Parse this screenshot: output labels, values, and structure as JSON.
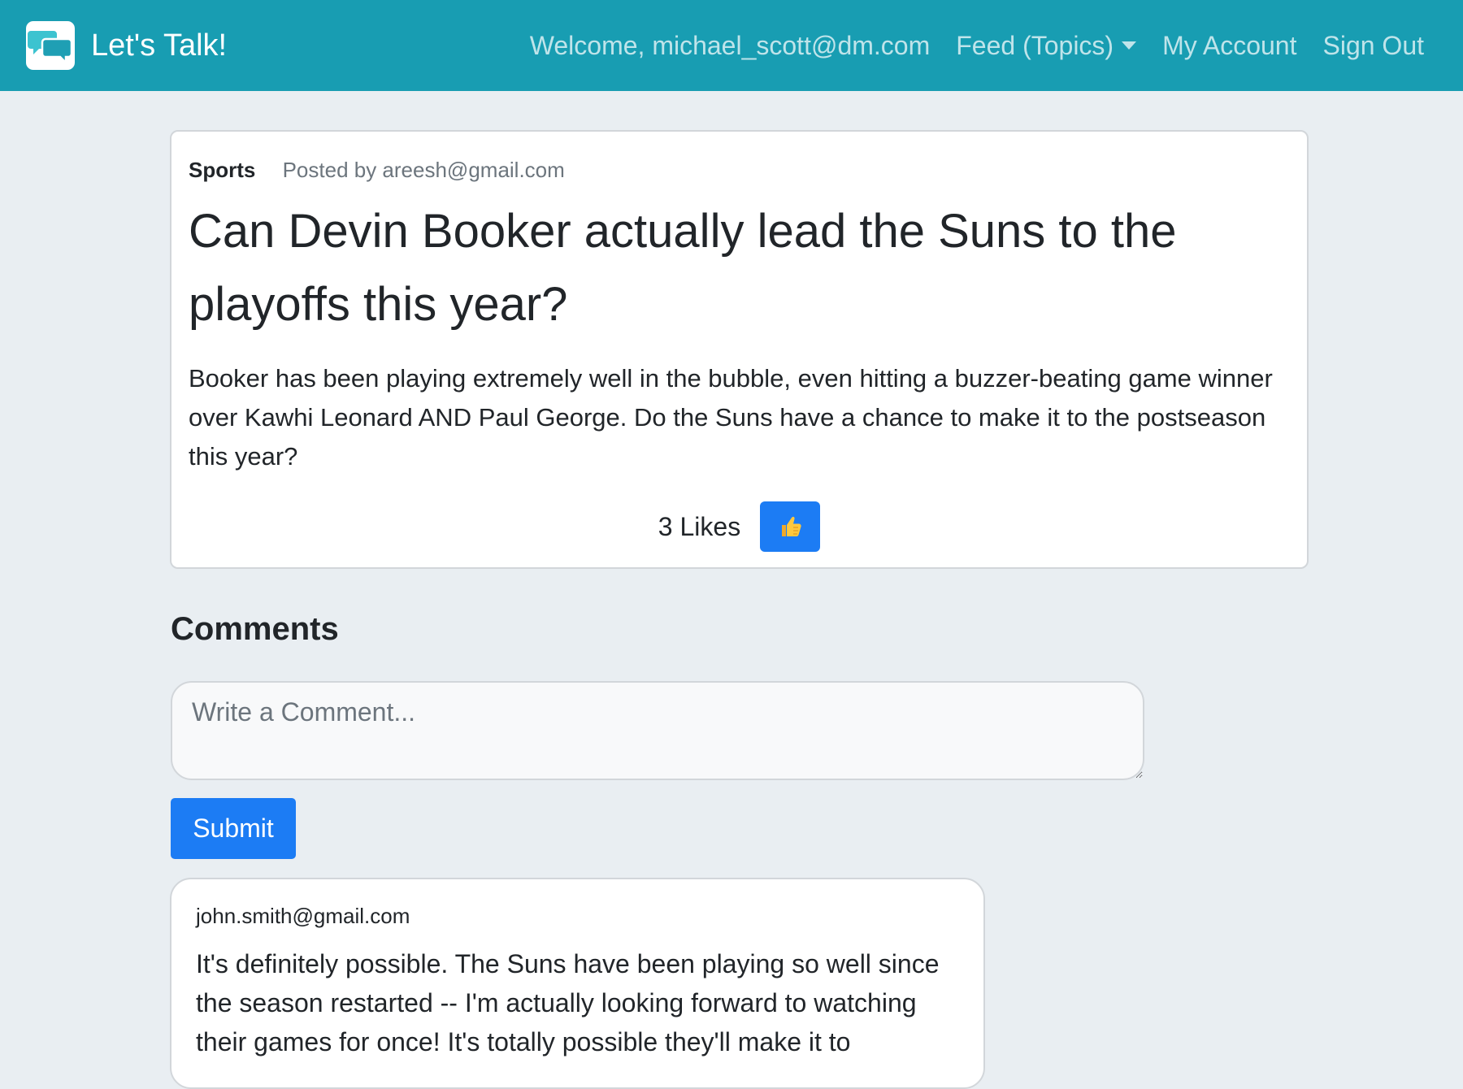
{
  "navbar": {
    "brand": "Let's Talk!",
    "welcome": "Welcome, michael_scott@dm.com",
    "feed": "Feed (Topics)",
    "account": "My Account",
    "signout": "Sign Out",
    "color": "#189db2"
  },
  "post": {
    "topic": "Sports",
    "author": "Posted by areesh@gmail.com",
    "title": "Can Devin Booker actually lead the Suns to the playoffs this year?",
    "body": "Booker has been playing extremely well in the bubble, even hitting a buzzer-beating game winner over Kawhi Leonard AND Paul George. Do the Suns have a chance to make it to the postseason this year?",
    "likes": "3 Likes",
    "like_icon": "thumbs-up-icon"
  },
  "comments": {
    "heading": "Comments",
    "placeholder": "Write a Comment...",
    "submit": "Submit",
    "items": [
      {
        "author": "john.smith@gmail.com",
        "text": "It's definitely possible. The Suns have been playing so well since the season restarted -- I'm actually looking forward to watching their games for once! It's totally possible they'll make it to"
      }
    ]
  },
  "colors": {
    "primary": "#1c7cf4",
    "background": "#e9eef2"
  }
}
